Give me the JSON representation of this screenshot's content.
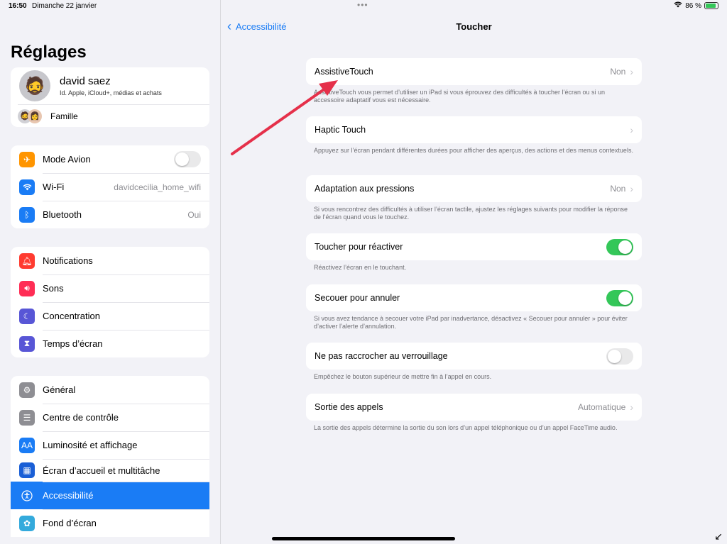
{
  "status": {
    "time": "16:50",
    "date": "Dimanche 22 janvier",
    "battery": "86 %",
    "battery_level": 0.86
  },
  "sidebar": {
    "title": "Réglages",
    "profile": {
      "name": "david saez",
      "subtitle": "Id. Apple, iCloud+, médias et achats",
      "family_label": "Famille"
    },
    "group1": [
      {
        "label": "Mode Avion",
        "icon": "airplane-icon",
        "color": "#ff9500",
        "toggle": false
      },
      {
        "label": "Wi-Fi",
        "icon": "wifi-icon",
        "color": "#1a7cf5",
        "value": "davidcecilia_home_wifi"
      },
      {
        "label": "Bluetooth",
        "icon": "bluetooth-icon",
        "color": "#1a7cf5",
        "value": "Oui"
      }
    ],
    "group2": [
      {
        "label": "Notifications",
        "icon": "bell-icon",
        "color": "#ff3b30"
      },
      {
        "label": "Sons",
        "icon": "speaker-icon",
        "color": "#ff2d55"
      },
      {
        "label": "Concentration",
        "icon": "moon-icon",
        "color": "#5856d6"
      },
      {
        "label": "Temps d’écran",
        "icon": "hourglass-icon",
        "color": "#5856d6"
      }
    ],
    "group3": [
      {
        "label": "Général",
        "icon": "gear-icon",
        "color": "#8e8e93"
      },
      {
        "label": "Centre de contrôle",
        "icon": "switches-icon",
        "color": "#8e8e93"
      },
      {
        "label": "Luminosité et affichage",
        "icon": "text-size-icon",
        "color": "#1a7cf5"
      },
      {
        "label": "Écran d’accueil et multitâche",
        "icon": "grid-icon",
        "color": "#1a5fd6"
      },
      {
        "label": "Accessibilité",
        "icon": "accessibility-icon",
        "color": "#1a7cf5",
        "selected": true
      },
      {
        "label": "Fond d’écran",
        "icon": "flower-icon",
        "color": "#34aadc"
      }
    ]
  },
  "detail": {
    "back_label": "Accessibilité",
    "title": "Toucher",
    "cells": [
      {
        "label": "AssistiveTouch",
        "value": "Non",
        "chevron": true,
        "note": "AssistiveTouch vous permet d’utiliser un iPad si vous éprouvez des difficultés à toucher l’écran ou si un accessoire adaptatif vous est nécessaire."
      },
      {
        "label": "Haptic Touch",
        "value": "",
        "chevron": true,
        "note": "Appuyez sur l’écran pendant différentes durées pour afficher des aperçus, des actions et des menus contextuels."
      },
      {
        "label": "Adaptation aux pressions",
        "value": "Non",
        "chevron": true,
        "note": "Si vous rencontrez des difficultés à utiliser l’écran tactile, ajustez les réglages suivants pour modifier la réponse de l’écran quand vous le touchez."
      },
      {
        "label": "Toucher pour réactiver",
        "toggle": true,
        "note": "Réactivez l’écran en le touchant."
      },
      {
        "label": "Secouer pour annuler",
        "toggle": true,
        "note": "Si vous avez tendance à secouer votre iPad par inadvertance, désactivez « Secouer pour annuler » pour éviter d’activer l’alerte d’annulation."
      },
      {
        "label": "Ne pas raccrocher au verrouillage",
        "toggle": false,
        "note": "Empêchez le bouton supérieur de mettre fin à l’appel en cours."
      },
      {
        "label": "Sortie des appels",
        "value": "Automatique",
        "chevron": true,
        "note": "La sortie des appels détermine la sortie du son lors d’un appel téléphonique ou d’un appel FaceTime audio."
      }
    ]
  },
  "colors": {
    "accent": "#1a7cf5",
    "toggle_on": "#34c759",
    "annotation_arrow": "#e5304a"
  }
}
